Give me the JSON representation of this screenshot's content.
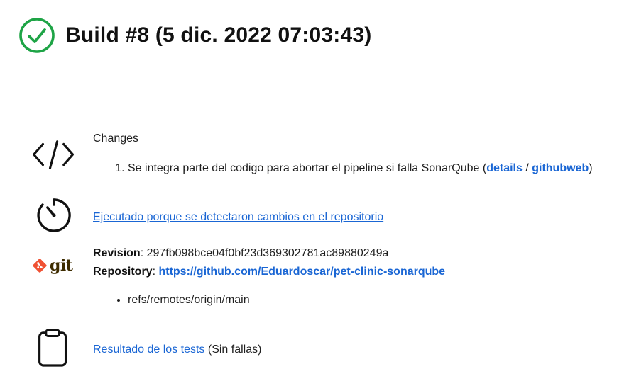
{
  "header": {
    "title": "Build #8 (5 dic. 2022 07:03:43)",
    "status_icon": "success-check-circle-icon",
    "status_color": "#1ea446"
  },
  "changes": {
    "icon": "code-icon",
    "heading": "Changes",
    "items": [
      {
        "text": "Se integra parte del codigo para abortar el pipeline si falla SonarQube (",
        "details_label": "details",
        "separator": " / ",
        "githubweb_label": "githubweb",
        "closing": ")"
      }
    ]
  },
  "trigger": {
    "icon": "timer-icon",
    "link_text": "Ejecutado porque se detectaron cambios en el repositorio"
  },
  "git": {
    "logo_text": "git",
    "logo_color": "#f05133",
    "revision_label": "Revision",
    "revision_value": "297fb098bce04f0bf23d369302781ac89880249a",
    "repository_label": "Repository",
    "repository_url": "https://github.com/Eduardoscar/pet-clinic-sonarqube",
    "refs": [
      "refs/remotes/origin/main"
    ]
  },
  "tests": {
    "icon": "clipboard-icon",
    "link_text": "Resultado de los tests",
    "status_text": "(Sin fallas)"
  },
  "colors": {
    "link": "#1a66d4",
    "text": "#1f1f1f"
  }
}
